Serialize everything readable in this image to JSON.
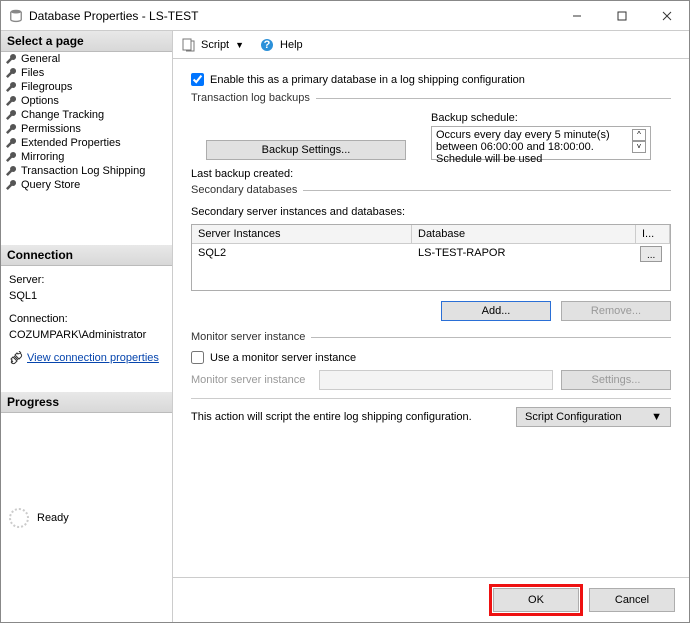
{
  "window": {
    "title": "Database Properties - LS-TEST"
  },
  "sidebar": {
    "select_page": "Select a page",
    "pages": [
      "General",
      "Files",
      "Filegroups",
      "Options",
      "Change Tracking",
      "Permissions",
      "Extended Properties",
      "Mirroring",
      "Transaction Log Shipping",
      "Query Store"
    ],
    "connection_header": "Connection",
    "server_label": "Server:",
    "server_value": "SQL1",
    "connection_label": "Connection:",
    "connection_value": "COZUMPARK\\Administrator",
    "view_conn_props": "View connection properties",
    "progress_header": "Progress",
    "progress_status": "Ready"
  },
  "toolbar": {
    "script": "Script",
    "help": "Help"
  },
  "main": {
    "enable_label": "Enable this as a primary database in a log shipping configuration",
    "txlog_group": "Transaction log backups",
    "backup_settings_btn": "Backup Settings...",
    "backup_schedule_label": "Backup schedule:",
    "backup_schedule_text": "Occurs every day every 5 minute(s) between 06:00:00 and 18:00:00. Schedule will be used",
    "last_backup_label": "Last backup created:",
    "secondary_group": "Secondary databases",
    "secondary_desc": "Secondary server instances and databases:",
    "col_server": "Server Instances",
    "col_db": "Database",
    "col_extra": "I...",
    "row_server": "SQL2",
    "row_db": "LS-TEST-RAPOR",
    "add_btn": "Add...",
    "remove_btn": "Remove...",
    "monitor_group": "Monitor server instance",
    "use_monitor": "Use a monitor server instance",
    "monitor_label": "Monitor server instance",
    "settings_btn": "Settings...",
    "script_note": "This action will script the entire log shipping configuration.",
    "script_config_btn": "Script Configuration"
  },
  "footer": {
    "ok": "OK",
    "cancel": "Cancel"
  }
}
